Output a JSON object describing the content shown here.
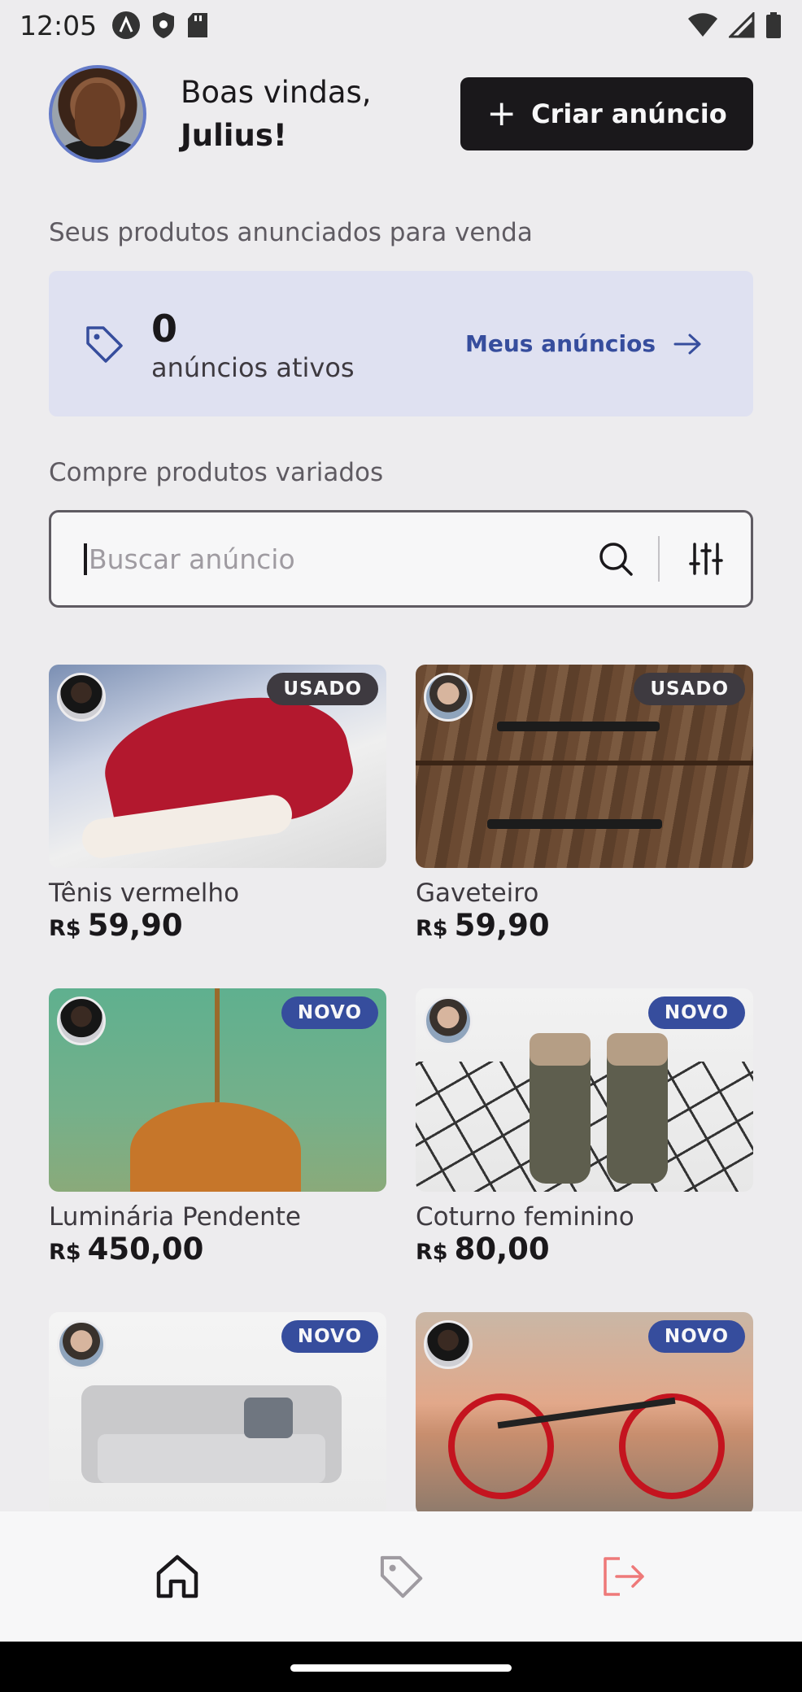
{
  "status_bar": {
    "time": "12:05"
  },
  "header": {
    "greeting": "Boas vindas,",
    "user_name": "Julius!",
    "create_button": "Criar anúncio"
  },
  "my_ads": {
    "section_title": "Seus produtos anunciados para venda",
    "count": "0",
    "label": "anúncios ativos",
    "link": "Meus anúncios"
  },
  "search": {
    "section_title": "Compre produtos variados",
    "placeholder": "Buscar anúncio",
    "value": ""
  },
  "products": [
    {
      "title": "Tênis vermelho",
      "currency": "R$",
      "price": "59,90",
      "condition": "USADO"
    },
    {
      "title": "Gaveteiro",
      "currency": "R$",
      "price": "59,90",
      "condition": "USADO"
    },
    {
      "title": "Luminária Pendente",
      "currency": "R$",
      "price": "450,00",
      "condition": "NOVO"
    },
    {
      "title": "Coturno feminino",
      "currency": "R$",
      "price": "80,00",
      "condition": "NOVO"
    },
    {
      "title": "",
      "currency": "",
      "price": "",
      "condition": "NOVO"
    },
    {
      "title": "",
      "currency": "",
      "price": "",
      "condition": "NOVO"
    }
  ],
  "colors": {
    "blue": "#364D9D",
    "blue_light": "#647AC7",
    "dark": "#1A181B",
    "red_logout": "#EE7979",
    "background": "#EDECEE"
  },
  "nav": {
    "items": [
      "home-icon",
      "tag-icon",
      "sign-out-icon"
    ]
  }
}
